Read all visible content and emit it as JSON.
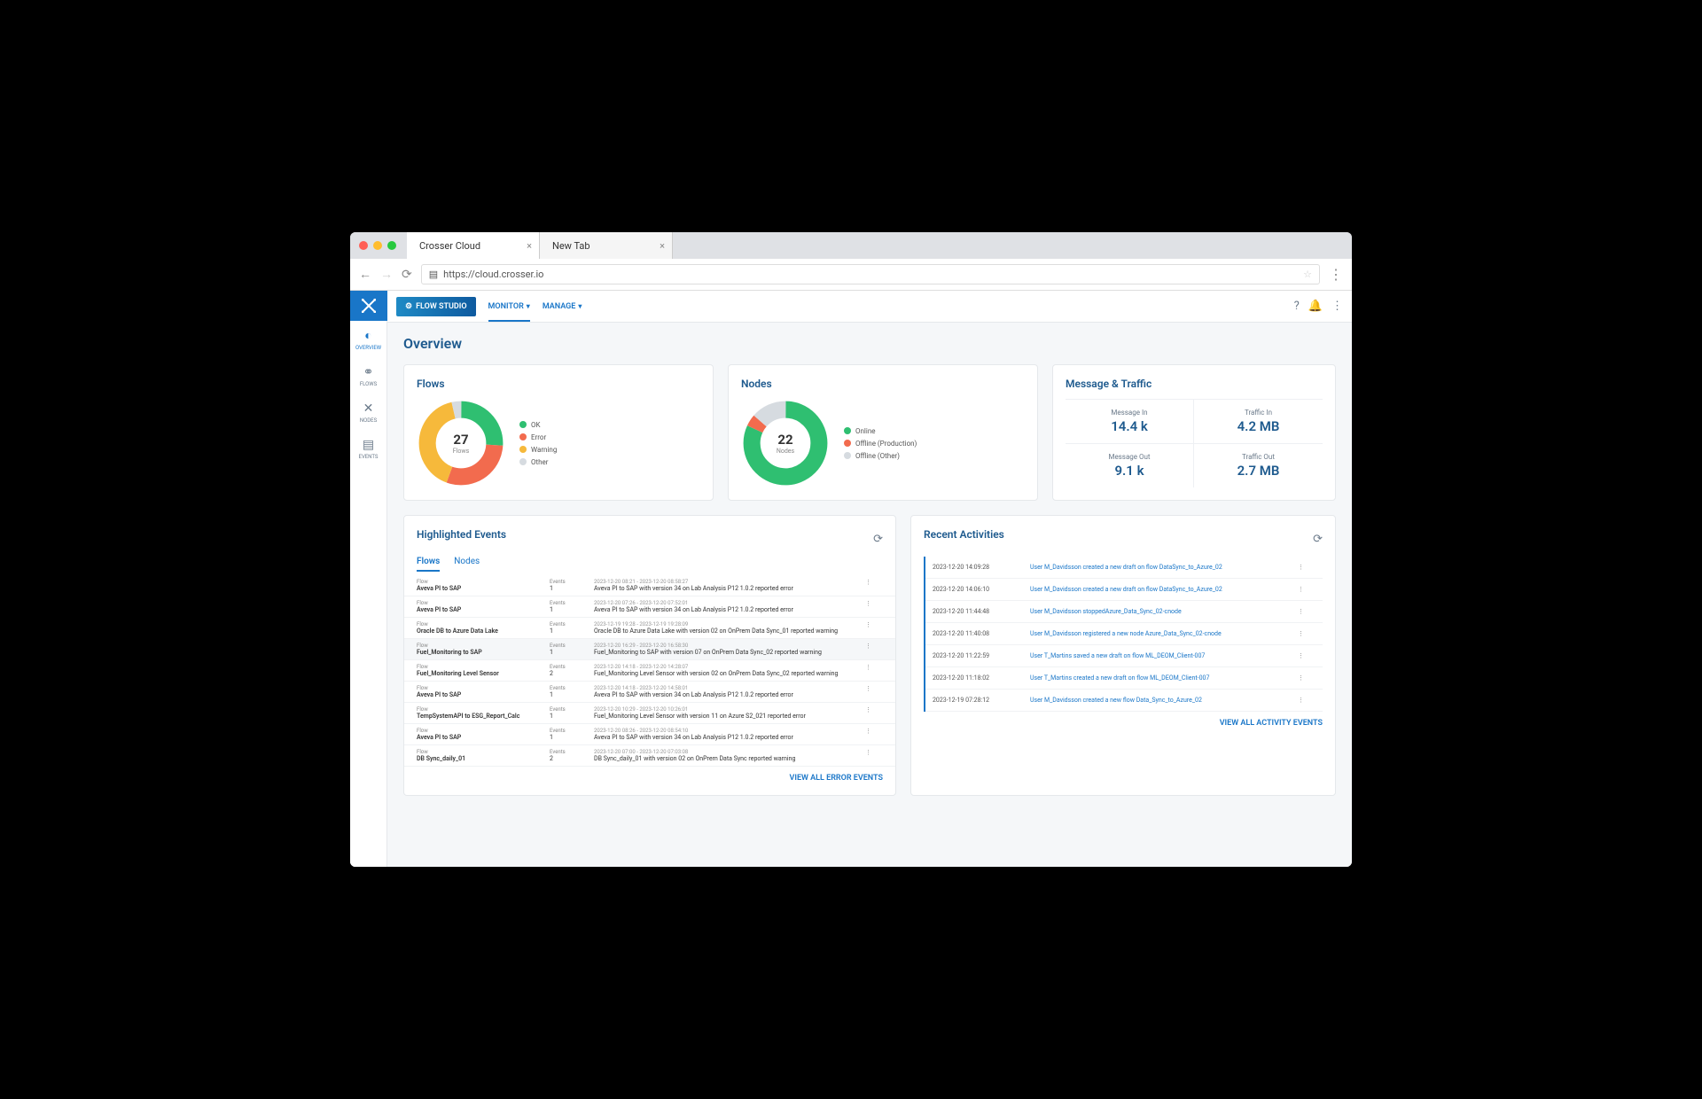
{
  "browser": {
    "tab1": "Crosser Cloud",
    "tab2": "New Tab",
    "url": "https://cloud.crosser.io"
  },
  "topbar": {
    "flow_studio": "FLOW STUDIO",
    "monitor": "MONITOR",
    "manage": "MANAGE"
  },
  "sidebar": {
    "overview": "OVERVIEW",
    "flows": "FLOWS",
    "nodes": "NODES",
    "events": "EVENTS"
  },
  "page": {
    "title": "Overview"
  },
  "flows_card": {
    "title": "Flows",
    "total": "27",
    "total_label": "Flows",
    "legend": [
      {
        "label": "OK",
        "color": "#2fbf71"
      },
      {
        "label": "Error",
        "color": "#f26b4e"
      },
      {
        "label": "Warning",
        "color": "#f6b93b"
      },
      {
        "label": "Other",
        "color": "#d6dbe0"
      }
    ]
  },
  "nodes_card": {
    "title": "Nodes",
    "total": "22",
    "total_label": "Nodes",
    "legend": [
      {
        "label": "Online",
        "color": "#2fbf71"
      },
      {
        "label": "Offline (Production)",
        "color": "#f26b4e"
      },
      {
        "label": "Offline (Other)",
        "color": "#d6dbe0"
      }
    ]
  },
  "metrics": {
    "title": "Message & Traffic",
    "msg_in_label": "Message In",
    "msg_in": "14.4 k",
    "traffic_in_label": "Traffic In",
    "traffic_in": "4.2 MB",
    "msg_out_label": "Message Out",
    "msg_out": "9.1 k",
    "traffic_out_label": "Traffic Out",
    "traffic_out": "2.7 MB"
  },
  "events": {
    "title": "Highlighted Events",
    "tab_flows": "Flows",
    "tab_nodes": "Nodes",
    "col_flow": "Flow",
    "col_events": "Events",
    "view_all": "VIEW ALL ERROR EVENTS",
    "rows": [
      {
        "name": "Aveva PI to SAP",
        "count": "1",
        "time": "2023-12-20 08:21 - 2023-12-20 08:58:27",
        "desc": "Aveva PI to SAP with version 34 on Lab Analysis P12 1.0.2 reported error"
      },
      {
        "name": "Aveva PI to SAP",
        "count": "1",
        "time": "2023-12-20 07:26 - 2023-12-20 07:52:01",
        "desc": "Aveva PI to SAP with version 34 on Lab Analysis P12 1.0.2 reported error"
      },
      {
        "name": "Oracle DB to Azure Data Lake",
        "count": "1",
        "time": "2023-12-19 19:28 - 2023-12-19 19:28:09",
        "desc": "Oracle DB to Azure Data Lake with version 02 on OnPrem Data Sync_01 reported warning"
      },
      {
        "name": "Fuel_Monitoring to SAP",
        "count": "1",
        "time": "2023-12-20 16:29 - 2023-12-20 16:58:30",
        "desc": "Fuel_Monitoring to SAP with version 07 on OnPrem Data Sync_02 reported warning",
        "highlight": true
      },
      {
        "name": "Fuel_Monitoring Level Sensor",
        "count": "2",
        "time": "2023-12-20 14:18 - 2023-12-20 14:28:07",
        "desc": "Fuel_Monitoring Level Sensor with version 02 on OnPrem Data Sync_02 reported warning"
      },
      {
        "name": "Aveva PI to SAP",
        "count": "1",
        "time": "2023-12-20 14:18 - 2023-12-20 14:58:01",
        "desc": "Aveva PI to SAP with version 34 on Lab Analysis P12 1.0.2 reported error"
      },
      {
        "name": "TempSystemAPI to ESG_Report_Calc",
        "count": "1",
        "time": "2023-12-20 10:29 - 2023-12-20 10:26:01",
        "desc": "Fuel_Monitoring Level Sensor with version 11 on Azure S2_021 reported error"
      },
      {
        "name": "Aveva PI to SAP",
        "count": "1",
        "time": "2023-12-20 08:26 - 2023-12-20 08:54:10",
        "desc": "Aveva PI to SAP with version 34 on Lab Analysis P12 1.0.2 reported error"
      },
      {
        "name": "DB Sync_daily_01",
        "count": "2",
        "time": "2023-12-20 07:00 - 2023-12-20 07:03:08",
        "desc": "DB Sync_daily_01 with version 02 on OnPrem Data Sync reported warning"
      }
    ]
  },
  "activities": {
    "title": "Recent Activities",
    "view_all": "VIEW ALL ACTIVITY EVENTS",
    "rows": [
      {
        "time": "2023-12-20 14:09:28",
        "desc": "User M_Davidsson created a new draft on flow DataSync_to_Azure_02"
      },
      {
        "time": "2023-12-20 14:06:10",
        "desc": "User M_Davidsson created a new draft on flow DataSync_to_Azure_02"
      },
      {
        "time": "2023-12-20 11:44:48",
        "desc": "User M_Davidsson stoppedAzure_Data_Sync_02-cnode"
      },
      {
        "time": "2023-12-20 11:40:08",
        "desc": "User M_Davidsson registered a new node Azure_Data_Sync_02-cnode"
      },
      {
        "time": "2023-12-20 11:22:59",
        "desc": "User T_Martins saved a new draft on flow ML_DEOM_Client-007"
      },
      {
        "time": "2023-12-20 11:18:02",
        "desc": "User T_Martins created a new draft on flow ML_DEOM_Client-007"
      },
      {
        "time": "2023-12-19 07:28:12",
        "desc": "User M_Davidsson created a new flow Data_Sync_to_Azure_02"
      }
    ]
  },
  "chart_data": [
    {
      "type": "pie",
      "title": "Flows",
      "total": 27,
      "series": [
        {
          "name": "OK",
          "value": 7,
          "color": "#2fbf71"
        },
        {
          "name": "Error",
          "value": 8,
          "color": "#f26b4e"
        },
        {
          "name": "Warning",
          "value": 11,
          "color": "#f6b93b"
        },
        {
          "name": "Other",
          "value": 1,
          "color": "#d6dbe0"
        }
      ]
    },
    {
      "type": "pie",
      "title": "Nodes",
      "total": 22,
      "series": [
        {
          "name": "Online",
          "value": 18,
          "color": "#2fbf71"
        },
        {
          "name": "Offline (Production)",
          "value": 1,
          "color": "#f26b4e"
        },
        {
          "name": "Offline (Other)",
          "value": 3,
          "color": "#d6dbe0"
        }
      ]
    }
  ]
}
